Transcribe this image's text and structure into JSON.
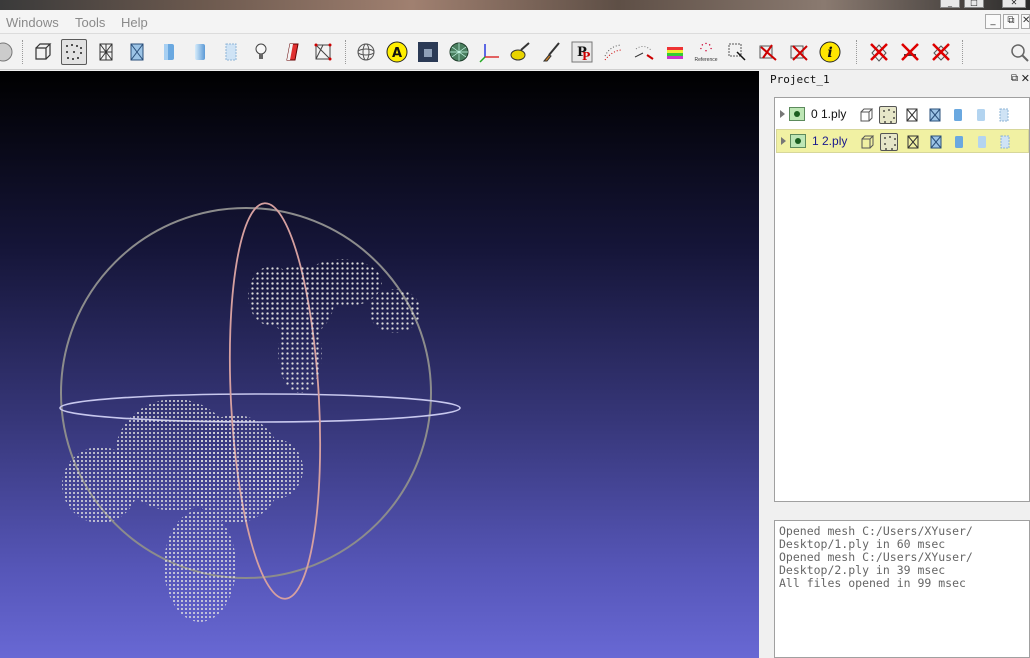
{
  "menu": {
    "items": [
      "Windows",
      "Tools",
      "Help"
    ]
  },
  "toolbar": {
    "icons": [
      "bbox-icon",
      "points-icon",
      "wireframe-icon",
      "hidden-lines-icon",
      "flat-shading-icon",
      "vertex-shading-icon",
      "face-shading-icon",
      "light-bulb-icon",
      "colorize-icon",
      "select-faces-icon",
      "sphere-trackball-icon",
      "annotation-icon",
      "camera-icon",
      "mesh-sphere-icon",
      "axes-icon",
      "paint-icon",
      "brush-icon",
      "pp-filter-icon",
      "align-icon",
      "translate-icon",
      "rainbow-icon",
      "reference-icon",
      "select-vertices-icon",
      "cut-icon",
      "cut-vertices-icon",
      "info-icon",
      "delete-faces-icon",
      "delete-vertices-icon",
      "delete-all-icon",
      "search-icon"
    ],
    "reference_label": "Reference"
  },
  "project": {
    "title": "Project_1"
  },
  "layers": [
    {
      "label": "0  1.ply",
      "selected": false
    },
    {
      "label": "1  2.ply",
      "selected": true
    }
  ],
  "log": [
    "Opened mesh C:/Users/XYuser/",
    "Desktop/1.ply in 60 msec",
    "Opened mesh C:/Users/XYuser/",
    "Desktop/2.ply in 39 msec",
    "All files opened in 99 msec"
  ]
}
